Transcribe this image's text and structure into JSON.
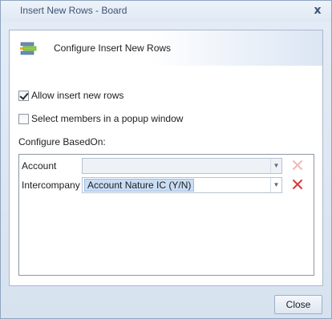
{
  "window": {
    "title": "Insert New Rows - Board",
    "close_glyph": "x"
  },
  "header": {
    "icon": "insert-rows-icon",
    "title": "Configure Insert New Rows"
  },
  "options": {
    "allow_insert": {
      "label": "Allow insert new rows",
      "checked": true
    },
    "popup_window": {
      "label": "Select members in a popup window",
      "checked": false
    }
  },
  "based_on": {
    "label": "Configure BasedOn:",
    "rows": [
      {
        "label": "Account",
        "value": "",
        "enabled": false
      },
      {
        "label": "Intercompany",
        "value": "Account Nature IC (Y/N)",
        "enabled": true
      }
    ]
  },
  "footer": {
    "close_label": "Close"
  },
  "colors": {
    "delete_active": "#d9383a",
    "delete_disabled": "#f0b8b8",
    "selection": "#c9ddf4"
  }
}
